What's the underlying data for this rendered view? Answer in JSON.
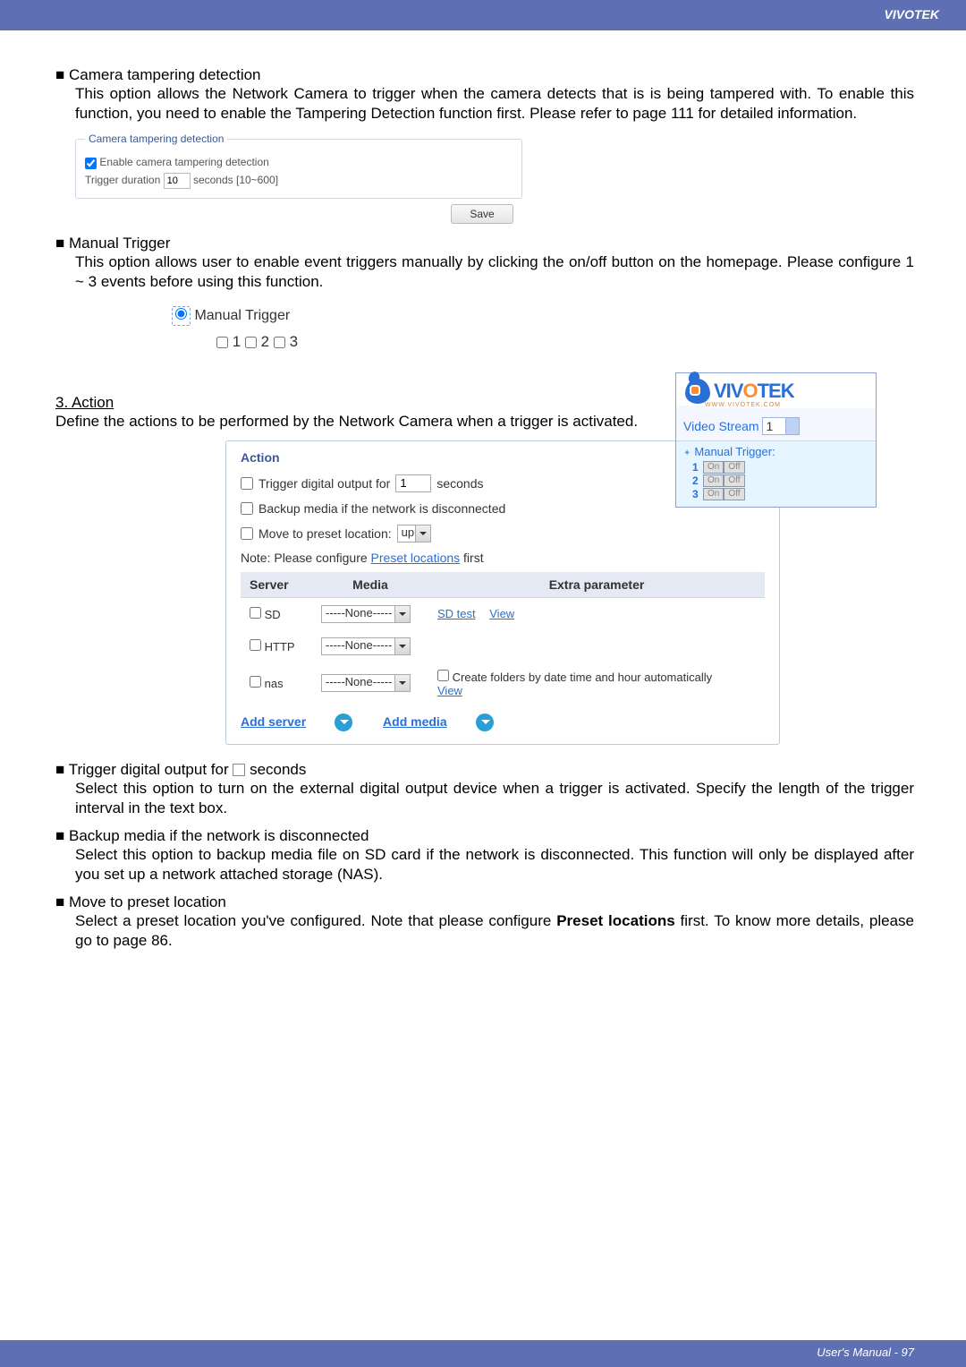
{
  "header": {
    "brand": "VIVOTEK"
  },
  "sec_tamper": {
    "bullet": "■",
    "title": "Camera tampering detection",
    "body": "This option allows the Network Camera to trigger when the camera detects that is is being tampered with. To enable this function, you need to enable the Tampering Detection function first. Please refer to page 111 for detailed information.",
    "legend": "Camera tampering detection",
    "cb_label": "Enable camera tampering detection",
    "dur_label": "Trigger duration",
    "dur_value": "10",
    "dur_hint": "seconds [10~600]",
    "save_btn": "Save"
  },
  "sec_manual": {
    "bullet": "■",
    "title": "Manual Trigger",
    "body": "This option allows user to enable event triggers manually by clicking the on/off button on the homepage. Please configure 1 ~ 3 events before using this function.",
    "radio_label": "Manual Trigger",
    "cb1": "1",
    "cb2": "2",
    "cb3": "3"
  },
  "viv_panel": {
    "logo_text": "VIVOTEK",
    "logo_url": "WWW.VIVOTEK.COM",
    "stream_label": "Video Stream",
    "stream_value": "1",
    "mt_title": "Manual Trigger:",
    "row1_num": "1",
    "row2_num": "2",
    "row3_num": "3",
    "on": "On",
    "off": "Off"
  },
  "sec_action_head": {
    "num_title": "3. Action",
    "desc": "Define the actions to be performed by the Network Camera when a trigger is activated."
  },
  "action_panel": {
    "legend": "Action",
    "row1_a": "Trigger digital output for",
    "row1_val": "1",
    "row1_b": "seconds",
    "row2": "Backup media if the network is disconnected",
    "row3_a": "Move to preset location:",
    "row3_sel": "up",
    "note_a": "Note: Please configure ",
    "note_link": "Preset locations",
    "note_b": " first",
    "th_server": "Server",
    "th_media": "Media",
    "th_extra": "Extra parameter",
    "r_sd": "SD",
    "r_http": "HTTP",
    "r_nas": "nas",
    "none": "-----None-----",
    "sd_test": "SD test",
    "view": "View",
    "nas_extra": "Create folders by date time and hour automatically",
    "add_server": "Add server",
    "add_media": "Add media"
  },
  "sec_tdo": {
    "bullet": "■",
    "title_a": "Trigger digital output for ",
    "title_b": " seconds",
    "body": "Select this option to turn on the external digital output device when a trigger is activated. Specify the length of the trigger interval in the text box."
  },
  "sec_backup": {
    "bullet": "■",
    "title": "Backup media if the network is disconnected",
    "body": "Select this option to backup media file on SD card if the network is disconnected. This function will only be displayed after you set up a network attached storage (NAS)."
  },
  "sec_move": {
    "bullet": "■",
    "title": "Move to preset location",
    "body_a": "Select a preset location you've configured. Note that please configure ",
    "body_bold": "Preset locations",
    "body_b": " first. To know more details, please go to page 86."
  },
  "footer": {
    "text": "User's Manual - 97"
  }
}
